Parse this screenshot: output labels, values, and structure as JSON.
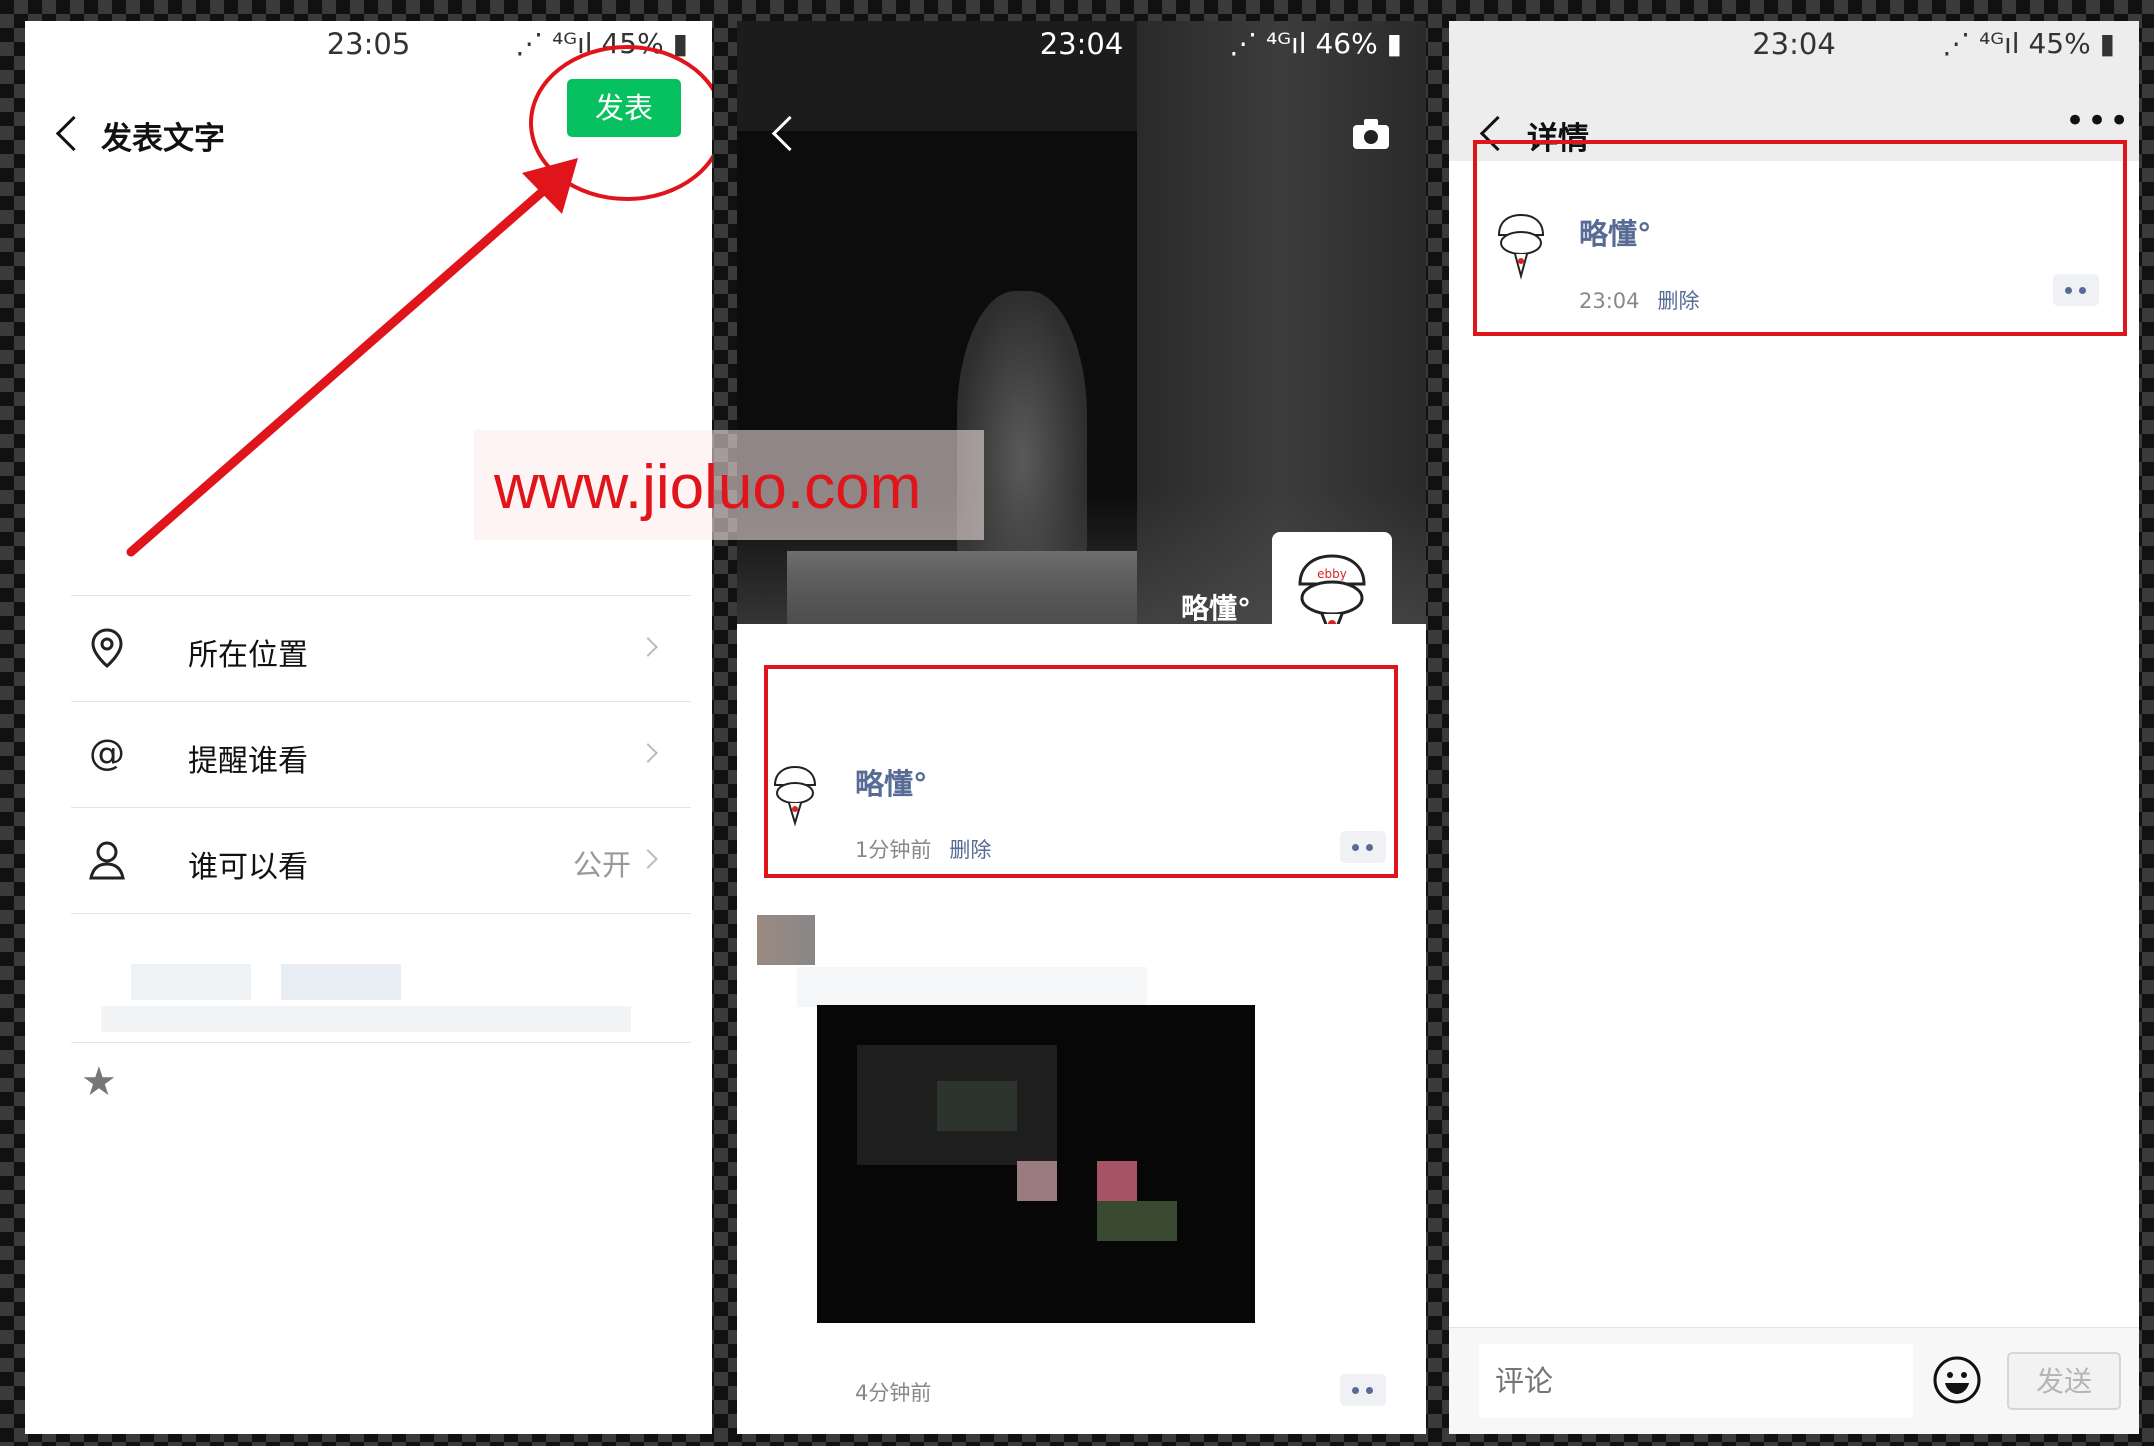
{
  "watermark": "www.jioluo.com",
  "panel1": {
    "status_time": "23:05",
    "status_right": "⋰ ⁴ᴳıl 45% ▮",
    "title": "发表文字",
    "publish_label": "发表",
    "options": [
      {
        "label": "所在位置",
        "value": ""
      },
      {
        "label": "提醒谁看",
        "value": ""
      },
      {
        "label": "谁可以看",
        "value": "公开"
      }
    ]
  },
  "panel2": {
    "status_time": "23:04",
    "status_right": "⋰ ⁴ᴳıl 46% ▮",
    "cover_name": "略懂°",
    "post": {
      "name": "略懂°",
      "time": "1分钟前",
      "delete": "删除"
    },
    "post2": {
      "time": "4分钟前"
    }
  },
  "panel3": {
    "status_time": "23:04",
    "status_right": "⋰ ⁴ᴳıl 45% ▮",
    "title": "详情",
    "post": {
      "name": "略懂°",
      "time": "23:04",
      "delete": "删除"
    },
    "comment_placeholder": "评论",
    "send_label": "发送"
  },
  "colors": {
    "accent_green": "#07c160",
    "link_blue": "#576b95",
    "annotation_red": "#e0141b"
  }
}
